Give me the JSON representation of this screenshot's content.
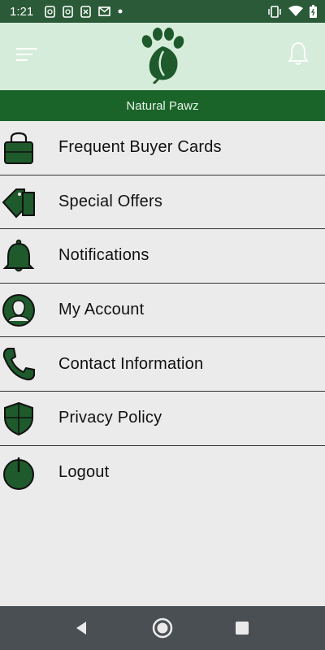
{
  "status_bar": {
    "time": "1:21",
    "left_icons": [
      "whatsapp-icon",
      "whatsapp-icon",
      "missed-call-icon",
      "gmail-icon",
      "dot-icon"
    ],
    "right_icons": [
      "vibrate-icon",
      "wifi-icon",
      "battery-icon"
    ]
  },
  "header": {
    "menu_icon": "hamburger-icon",
    "logo": "paw-logo",
    "bell_icon": "bell-icon"
  },
  "title": "Natural Pawz",
  "menu": [
    {
      "label": "Frequent Buyer Cards",
      "icon": "bag-icon"
    },
    {
      "label": "Special Offers",
      "icon": "tag-icon"
    },
    {
      "label": "Notifications",
      "icon": "bell-icon"
    },
    {
      "label": "My Account",
      "icon": "user-icon"
    },
    {
      "label": "Contact Information",
      "icon": "phone-icon"
    },
    {
      "label": "Privacy Policy",
      "icon": "shield-icon"
    },
    {
      "label": "Logout",
      "icon": "power-icon"
    }
  ],
  "nav": {
    "back": "back-icon",
    "home": "home-icon",
    "recents": "recents-icon"
  },
  "colors": {
    "status_bar": "#2a5a37",
    "header_bg": "#d6ecda",
    "title_bar": "#1a6429",
    "icon_green": "#1e5a2b",
    "list_bg": "#ebebeb",
    "nav_bar": "#4a4f54"
  }
}
